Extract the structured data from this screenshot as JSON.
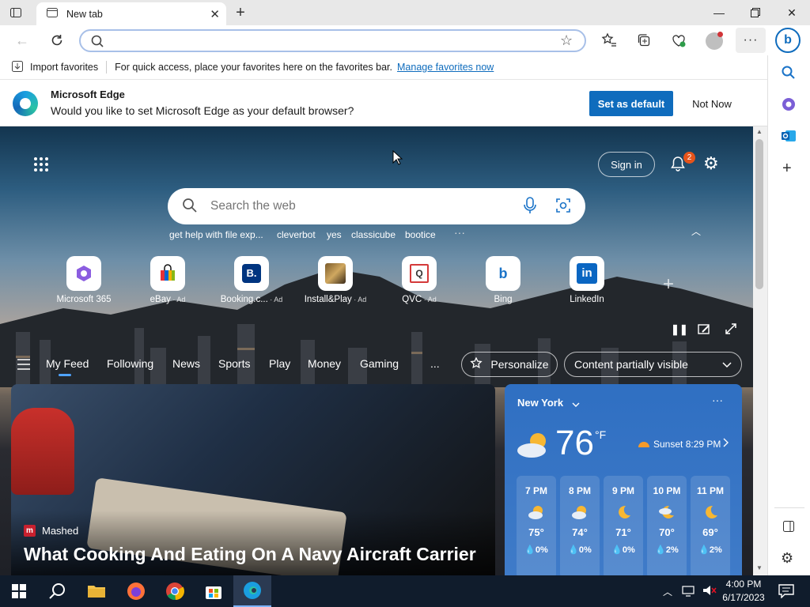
{
  "tab": {
    "title": "New tab"
  },
  "address": {
    "placeholder": ""
  },
  "favorites_bar": {
    "import_label": "Import favorites",
    "hint": "For quick access, place your favorites here on the favorites bar.",
    "manage_link": "Manage favorites now"
  },
  "infobar": {
    "title": "Microsoft Edge",
    "message": "Would you like to set Microsoft Edge as your default browser?",
    "primary_button": "Set as default",
    "secondary_button": "Not Now"
  },
  "header": {
    "sign_in": "Sign in",
    "notification_count": "2"
  },
  "search": {
    "placeholder": "Search the web"
  },
  "suggestions": [
    "get help with file exp...",
    "cleverbot",
    "yes",
    "classicube",
    "bootice"
  ],
  "quick_links": [
    {
      "label": "Microsoft 365",
      "ad": ""
    },
    {
      "label": "eBay",
      "ad": "Ad"
    },
    {
      "label": "Booking.c...",
      "ad": "Ad"
    },
    {
      "label": "Install&Play",
      "ad": "Ad"
    },
    {
      "label": "QVC",
      "ad": "Ad"
    },
    {
      "label": "Bing",
      "ad": ""
    },
    {
      "label": "LinkedIn",
      "ad": ""
    }
  ],
  "feed_nav": {
    "items": [
      "My Feed",
      "Following",
      "News",
      "Sports",
      "Play",
      "Money",
      "Gaming"
    ],
    "more": "...",
    "personalize": "Personalize",
    "content_visibility": "Content partially visible"
  },
  "article": {
    "source": "Mashed",
    "headline": "What Cooking And Eating On A Navy Aircraft Carrier"
  },
  "weather": {
    "location": "New York",
    "temperature": "76",
    "unit": "°F",
    "sunset": "Sunset 8:29 PM",
    "hourly": [
      {
        "time": "7 PM",
        "temp": "75°",
        "precip": "0%"
      },
      {
        "time": "8 PM",
        "temp": "74°",
        "precip": "0%"
      },
      {
        "time": "9 PM",
        "temp": "71°",
        "precip": "0%"
      },
      {
        "time": "10 PM",
        "temp": "70°",
        "precip": "2%"
      },
      {
        "time": "11 PM",
        "temp": "69°",
        "precip": "2%"
      }
    ]
  },
  "taskbar": {
    "time": "4:00 PM",
    "date": "6/17/2023"
  },
  "colors": {
    "accent": "#0f6cbd",
    "badge": "#e6541b",
    "weather_bg": "#3573c4",
    "taskbar": "#101c2c"
  }
}
